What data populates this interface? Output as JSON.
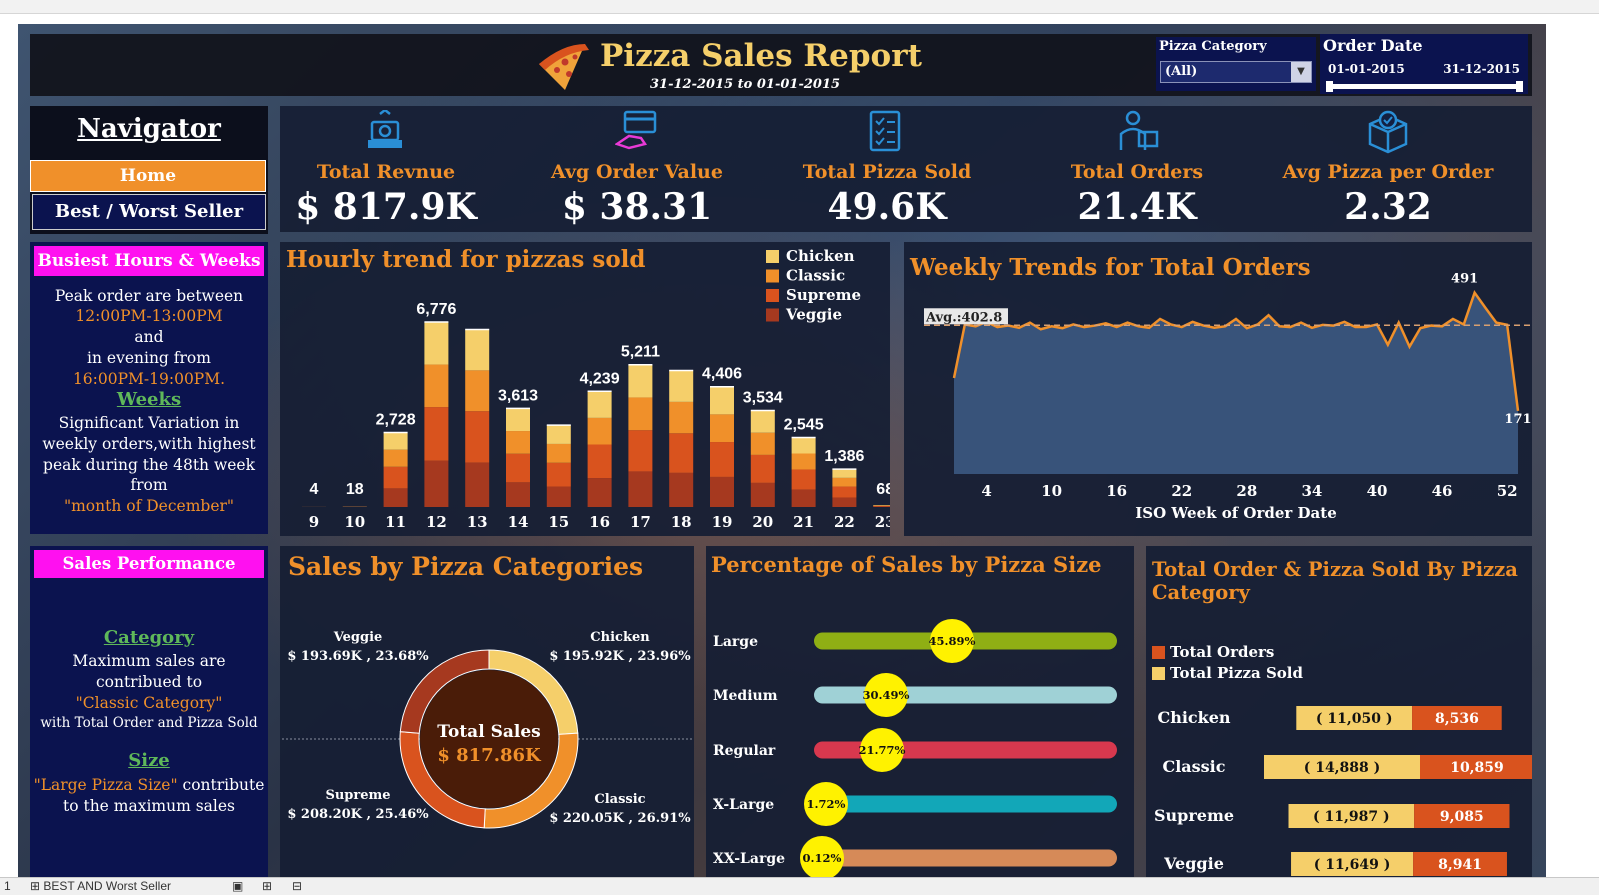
{
  "report": {
    "title": "Pizza Sales Report",
    "date_range": "31-12-2015 to 01-01-2015"
  },
  "filters": {
    "category_label": "Pizza Category",
    "category_value": "(All)",
    "date_label": "Order Date",
    "date_start": "01-01-2015",
    "date_end": "31-12-2015"
  },
  "navigator": {
    "title": "Navigator",
    "home": "Home",
    "best_worst": "Best / Worst Seller"
  },
  "kpis": [
    {
      "label": "Total Revnue",
      "value": "$ 817.9K",
      "icon": "money-hand-icon"
    },
    {
      "label": "Avg Order Value",
      "value": "$ 38.31",
      "icon": "card-payment-icon"
    },
    {
      "label": "Total Pizza Sold",
      "value": "49.6K",
      "icon": "checklist-icon"
    },
    {
      "label": "Total Orders",
      "value": "21.4K",
      "icon": "delivery-person-icon"
    },
    {
      "label": "Avg Pizza per Order",
      "value": "2.32",
      "icon": "box-check-icon"
    }
  ],
  "busiest": {
    "title": "Busiest Hours & Weeks",
    "line1": "Peak order are between",
    "line2": "12:00PM-13:00PM",
    "line3": "and",
    "line4": "in evening from",
    "line5": "16:00PM-19:00PM.",
    "weeks_heading": "Weeks",
    "w1": "Significant Variation in",
    "w2": "weekly orders,with highest",
    "w3": "peak during the 48th week",
    "w4": "from",
    "w5": "\"month of December\""
  },
  "sales_perf": {
    "title": "Sales Performance",
    "category_heading": "Category",
    "c1": "Maximum sales are",
    "c2": "contribued to",
    "c3": "\"Classic Category\"",
    "c4": "with Total Order  and Pizza Sold",
    "size_heading": "Size",
    "s1a": "\"Large Pizza Size\"",
    "s1b": " contribute",
    "s2": "to the maximum sales"
  },
  "chart_data": [
    {
      "id": "hourly",
      "type": "bar",
      "title": "Hourly trend for pizzas sold",
      "legend": [
        "Chicken",
        "Classic",
        "Supreme",
        "Veggie"
      ],
      "legend_colors": [
        "#f5cf6a",
        "#f0902a",
        "#d9531e",
        "#a6391f"
      ],
      "categories": [
        "9",
        "10",
        "11",
        "12",
        "13",
        "14",
        "15",
        "16",
        "17",
        "18",
        "19",
        "20",
        "21",
        "22",
        "23"
      ],
      "totals": [
        4,
        18,
        2728,
        6776,
        6500,
        3613,
        3000,
        4239,
        5211,
        5000,
        4406,
        3534,
        2545,
        1386,
        68
      ],
      "labels": [
        "4",
        "18",
        "2,728",
        "6,776",
        "",
        "3,613",
        "",
        "4,239",
        "5,211",
        "",
        "4,406",
        "3,534",
        "2,545",
        "1,386",
        "68"
      ],
      "stack_shares": [
        0.23,
        0.23,
        0.29,
        0.25
      ]
    },
    {
      "id": "weekly",
      "type": "area",
      "title": "Weekly Trends for Total Orders",
      "xlabel": "ISO Week of Order Date",
      "x_ticks": [
        4,
        10,
        16,
        22,
        28,
        34,
        40,
        46,
        52
      ],
      "avg_label": "Avg.:402.8",
      "avg": 402.8,
      "ylim": [
        0,
        520
      ],
      "x": [
        1,
        2,
        3,
        4,
        5,
        6,
        7,
        8,
        9,
        10,
        11,
        12,
        13,
        14,
        15,
        16,
        17,
        18,
        19,
        20,
        21,
        22,
        23,
        24,
        25,
        26,
        27,
        28,
        29,
        30,
        31,
        32,
        33,
        34,
        35,
        36,
        37,
        38,
        39,
        40,
        41,
        42,
        43,
        44,
        45,
        46,
        47,
        48,
        49,
        50,
        51,
        52,
        53
      ],
      "values": [
        260,
        405,
        400,
        412,
        398,
        402,
        396,
        410,
        392,
        400,
        395,
        405,
        398,
        402,
        408,
        398,
        410,
        400,
        396,
        420,
        405,
        398,
        412,
        402,
        396,
        400,
        420,
        395,
        405,
        430,
        400,
        398,
        410,
        396,
        404,
        402,
        412,
        398,
        398,
        405,
        350,
        410,
        345,
        395,
        402,
        400,
        420,
        405,
        491,
        450,
        410,
        404,
        171
      ],
      "labels": {
        "max": "491",
        "min": "171"
      }
    },
    {
      "id": "categories",
      "type": "pie",
      "title": "Sales by Pizza Categories",
      "center_label": "Total Sales",
      "center_value": "$ 817.86K",
      "slices": [
        {
          "name": "Chicken",
          "value": 23.96,
          "label": "$ 195.92K ,  23.96%",
          "color": "#f5cf6a"
        },
        {
          "name": "Classic",
          "value": 26.91,
          "label": "$ 220.05K ,  26.91%",
          "color": "#f0902a"
        },
        {
          "name": "Supreme",
          "value": 25.46,
          "label": "$ 208.20K ,  25.46%",
          "color": "#d9531e"
        },
        {
          "name": "Veggie",
          "value": 23.68,
          "label": "$ 193.69K ,  23.68%",
          "color": "#a6391f"
        }
      ]
    },
    {
      "id": "size",
      "type": "bar",
      "title": "Percentage of Sales by Pizza Size",
      "categories": [
        "Large",
        "Medium",
        "Regular",
        "X-Large",
        "XX-Large"
      ],
      "values": [
        45.89,
        30.49,
        21.77,
        1.72,
        0.12
      ],
      "labels": [
        "45.89%",
        "30.49%",
        "21.77%",
        "1.72%",
        "0.12%"
      ],
      "colors": [
        "#8faf14",
        "#9fd1d6",
        "#d8384e",
        "#12a7b8",
        "#d68a58"
      ]
    },
    {
      "id": "order-pizza",
      "type": "bar",
      "title": "Total Order & Pizza Sold By Pizza Category",
      "legend": [
        "Total Orders",
        "Total Pizza Sold"
      ],
      "legend_colors": [
        "#d9531e",
        "#f5cf6a"
      ],
      "categories": [
        "Chicken",
        "Classic",
        "Supreme",
        "Veggie"
      ],
      "series": [
        {
          "name": "Total Pizza Sold",
          "values": [
            11050,
            14888,
            11987,
            11649
          ],
          "labels": [
            "( 11,050 )",
            "( 14,888 )",
            "( 11,987 )",
            "( 11,649 )"
          ]
        },
        {
          "name": "Total Orders",
          "values": [
            8536,
            10859,
            9085,
            8941
          ],
          "labels": [
            "8,536",
            "10,859",
            "9,085",
            "8,941"
          ]
        }
      ]
    }
  ],
  "tabbar": {
    "sheet_num": "1",
    "sheet_name": "BEST AND Worst Seller"
  }
}
